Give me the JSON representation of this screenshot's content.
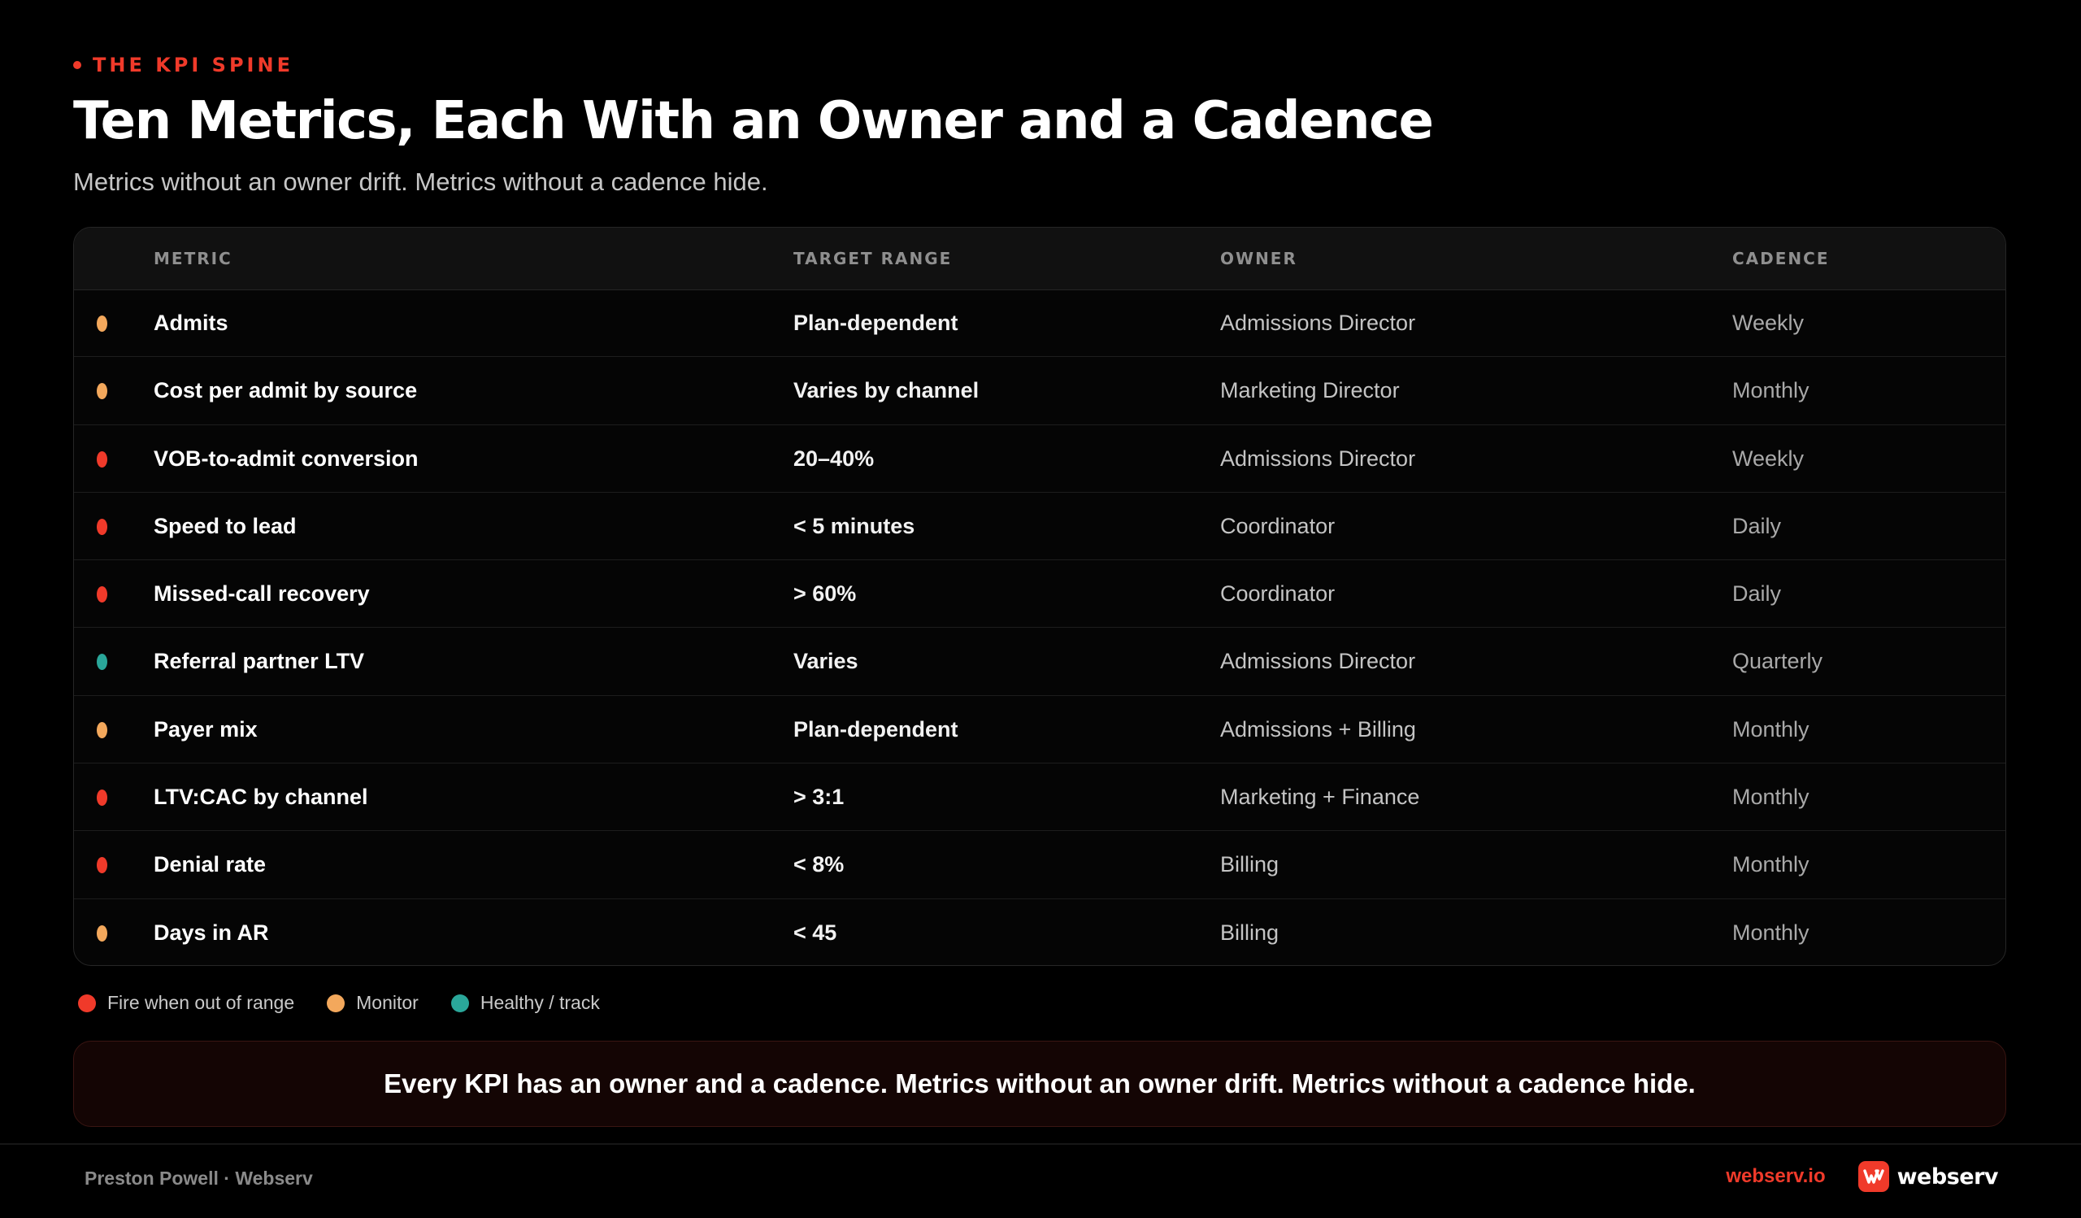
{
  "header": {
    "eyebrow": "THE KPI SPINE",
    "title": "Ten Metrics, Each With an Owner and a Cadence",
    "subtitle": "Metrics without an owner drift. Metrics without a cadence hide."
  },
  "colors": {
    "accent": "#f03a2a",
    "fire": "#f03a2a",
    "monitor": "#f3a85c",
    "healthy": "#2aa79a"
  },
  "table": {
    "columns": {
      "metric": "METRIC",
      "target": "TARGET RANGE",
      "owner": "OWNER",
      "cadence": "CADENCE"
    },
    "rows": [
      {
        "status": "monitor",
        "metric": "Admits",
        "target": "Plan-dependent",
        "owner": "Admissions Director",
        "cadence": "Weekly"
      },
      {
        "status": "monitor",
        "metric": "Cost per admit by source",
        "target": "Varies by channel",
        "owner": "Marketing Director",
        "cadence": "Monthly"
      },
      {
        "status": "fire",
        "metric": "VOB-to-admit conversion",
        "target": "20–40%",
        "owner": "Admissions Director",
        "cadence": "Weekly"
      },
      {
        "status": "fire",
        "metric": "Speed to lead",
        "target": "< 5 minutes",
        "owner": "Coordinator",
        "cadence": "Daily"
      },
      {
        "status": "fire",
        "metric": "Missed-call recovery",
        "target": "> 60%",
        "owner": "Coordinator",
        "cadence": "Daily"
      },
      {
        "status": "healthy",
        "metric": "Referral partner LTV",
        "target": "Varies",
        "owner": "Admissions Director",
        "cadence": "Quarterly"
      },
      {
        "status": "monitor",
        "metric": "Payer mix",
        "target": "Plan-dependent",
        "owner": "Admissions + Billing",
        "cadence": "Monthly"
      },
      {
        "status": "fire",
        "metric": "LTV:CAC by channel",
        "target": "> 3:1",
        "owner": "Marketing + Finance",
        "cadence": "Monthly"
      },
      {
        "status": "fire",
        "metric": "Denial rate",
        "target": "< 8%",
        "owner": "Billing",
        "cadence": "Monthly"
      },
      {
        "status": "monitor",
        "metric": "Days in AR",
        "target": "< 45",
        "owner": "Billing",
        "cadence": "Monthly"
      }
    ]
  },
  "legend": {
    "fire": "Fire when out of range",
    "monitor": "Monitor",
    "healthy": "Healthy / track"
  },
  "callout": {
    "text": "Every KPI has an owner and a cadence. Metrics without an owner drift. Metrics without a cadence hide."
  },
  "footer": {
    "author": "Preston Powell · Webserv",
    "url": "webserv.io",
    "brand_name": "webserv",
    "brand_icon": "webserv-logo-icon"
  }
}
